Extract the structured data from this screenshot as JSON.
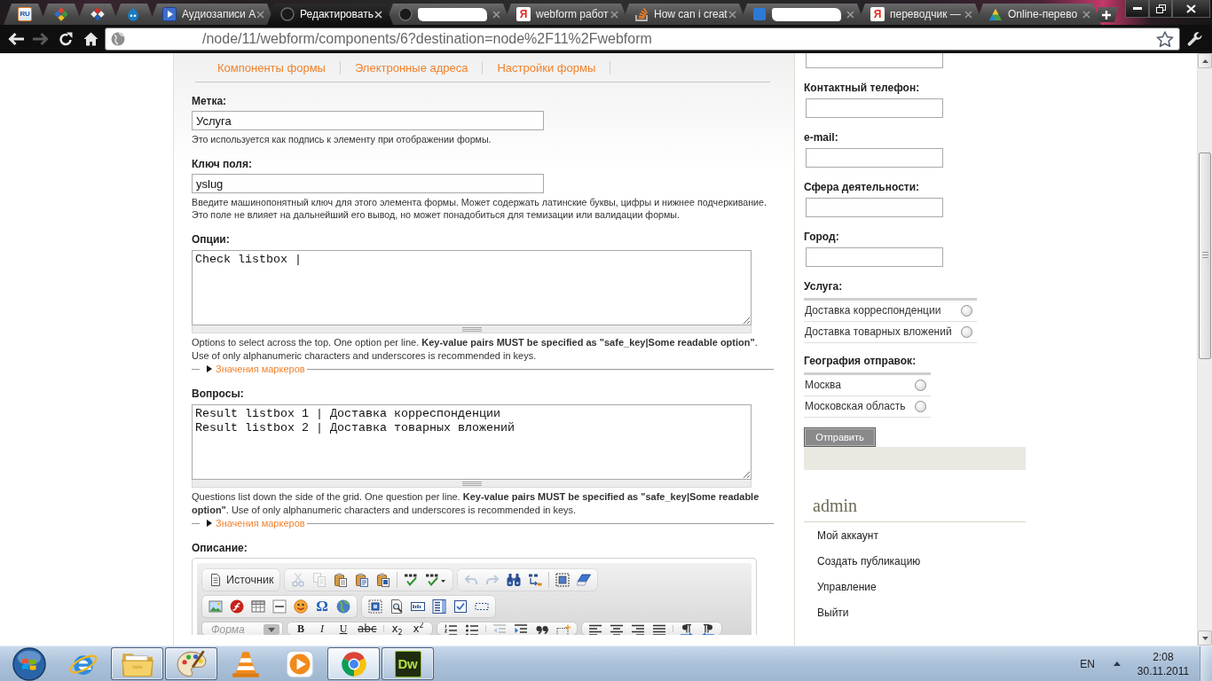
{
  "browser": {
    "tabs": [
      {
        "kind": "pinned",
        "icon_text": "RU",
        "selected": false
      },
      {
        "kind": "pinned",
        "selected": false
      },
      {
        "kind": "pinned",
        "selected": false
      },
      {
        "kind": "pinned",
        "selected": false
      },
      {
        "kind": "page",
        "title": "Аудиозаписи А",
        "selected": false
      },
      {
        "kind": "page",
        "title": "Редактировать",
        "selected": true
      },
      {
        "kind": "redacted",
        "selected": false
      },
      {
        "kind": "page",
        "title": "webform работ",
        "icon_text": "Я",
        "selected": false
      },
      {
        "kind": "page",
        "title": "How can i creat",
        "selected": false
      },
      {
        "kind": "redacted",
        "selected": false
      },
      {
        "kind": "page",
        "title": "переводчик —",
        "icon_text": "Я",
        "selected": false
      },
      {
        "kind": "page",
        "title": "Online-перево",
        "selected": false
      }
    ],
    "back_disabled": false,
    "forward_disabled": true,
    "address": "/node/11/webform/components/6?destination=node%2F11%2Fwebform"
  },
  "form_tabs": [
    "Компоненты формы",
    "Электронные адреса",
    "Настройки формы"
  ],
  "fields": [
    {
      "kind": "text",
      "label": "Метка:",
      "value": "Услуга",
      "description": "Это используется как подпись к элементу при отображении формы."
    },
    {
      "kind": "text",
      "label": "Ключ поля:",
      "value": "yslug",
      "description": "Введите машинопонятный ключ для этого элемента формы. Может содержать латинские буквы, цифры и нижнее подчеркивание. Это поле не влияет на дальнейший его вывод, но может понадобиться для темизации или валидации формы."
    },
    {
      "kind": "textarea",
      "label": "Опции:",
      "value": "Check listbox |",
      "description": "Options to select across the top. One option per line. **Key-value pairs MUST be specified as \"safe_key|Some readable option\"**. Use of only alphanumeric characters and underscores is recommended in keys.",
      "fieldset": {
        "title": "Значения маркеров",
        "expanded": false
      }
    },
    {
      "kind": "textarea",
      "label": "Вопросы:",
      "value": "Result listbox 1 | Доставка корреспонденции\nResult listbox 2 | Доставка товарных вложений",
      "description": "Questions list down the side of the grid. One question per line. **Key-value pairs MUST be specified as \"safe_key|Some readable option\"**. Use of only alphanumeric characters and underscores is recommended in keys.",
      "fieldset": {
        "title": "Значения маркеров",
        "expanded": false
      }
    },
    {
      "kind": "editor",
      "label": "Описание:",
      "toolbar": [
        [
          {
            "kind": "buttons",
            "sections": [
              [
                {
                  "kind": "source",
                  "label": "Источник",
                  "disabled": false
                }
              ]
            ]
          },
          {
            "kind": "buttons",
            "sections": [
              [
                {
                  "kind": "cut",
                  "disabled": true
                },
                {
                  "kind": "copy",
                  "disabled": true
                },
                {
                  "kind": "paste",
                  "disabled": false
                },
                {
                  "kind": "pastetext",
                  "disabled": false
                },
                {
                  "kind": "pasteword",
                  "disabled": false
                }
              ],
              [
                {
                  "kind": "spellcheck",
                  "disabled": false
                },
                {
                  "kind": "scayt",
                  "disabled": false
                }
              ]
            ]
          },
          {
            "kind": "buttons",
            "sections": [
              [
                {
                  "kind": "undo",
                  "disabled": true
                },
                {
                  "kind": "redo",
                  "disabled": true
                },
                {
                  "kind": "find",
                  "disabled": false
                },
                {
                  "kind": "replace",
                  "disabled": false
                }
              ],
              [
                {
                  "kind": "selectall",
                  "disabled": false
                },
                {
                  "kind": "removeformat",
                  "disabled": false
                }
              ]
            ]
          }
        ],
        [
          {
            "kind": "buttons",
            "sections": [
              [
                {
                  "kind": "image",
                  "disabled": false
                },
                {
                  "kind": "flash",
                  "disabled": false
                },
                {
                  "kind": "table",
                  "disabled": false
                },
                {
                  "kind": "hrule",
                  "disabled": false
                },
                {
                  "kind": "smiley",
                  "disabled": false
                },
                {
                  "kind": "specialchar",
                  "glyph": "Ω",
                  "disabled": false
                },
                {
                  "kind": "iframe",
                  "disabled": false
                }
              ]
            ]
          },
          {
            "kind": "buttons",
            "sections": [
              [
                {
                  "kind": "form",
                  "disabled": false
                },
                {
                  "kind": "imagebutton",
                  "disabled": false
                },
                {
                  "kind": "textfield",
                  "disabled": false
                },
                {
                  "kind": "select",
                  "disabled": false
                },
                {
                  "kind": "checkbox",
                  "disabled": false
                },
                {
                  "kind": "hiddenfield",
                  "disabled": false
                }
              ]
            ]
          }
        ],
        [
          {
            "kind": "combo",
            "label": "Форма"
          },
          {
            "kind": "buttons",
            "sections": [
              [
                {
                  "kind": "bold",
                  "glyph": "B",
                  "disabled": false
                },
                {
                  "kind": "italic",
                  "glyph": "I",
                  "disabled": false
                },
                {
                  "kind": "underline",
                  "glyph": "U",
                  "disabled": false
                },
                {
                  "kind": "strike",
                  "glyph": "abc",
                  "disabled": false
                }
              ],
              [
                {
                  "kind": "subscript",
                  "glyph": "x$_{2}$",
                  "disabled": false
                },
                {
                  "kind": "superscript",
                  "glyph": "x$^{2}$",
                  "disabled": false
                }
              ]
            ]
          },
          {
            "kind": "buttons",
            "sections": [
              [
                {
                  "kind": "numlist",
                  "disabled": false
                },
                {
                  "kind": "bullist",
                  "disabled": false
                }
              ],
              [
                {
                  "kind": "outdent",
                  "disabled": true
                },
                {
                  "kind": "indent",
                  "disabled": false
                },
                {
                  "kind": "blockquote",
                  "disabled": false
                },
                {
                  "kind": "creatediv",
                  "disabled": false
                }
              ]
            ]
          },
          {
            "kind": "buttons",
            "sections": [
              [
                {
                  "kind": "alignleft",
                  "disabled": false
                },
                {
                  "kind": "aligncenter",
                  "disabled": false
                },
                {
                  "kind": "alignright",
                  "disabled": false
                },
                {
                  "kind": "justify",
                  "disabled": false
                }
              ],
              [
                {
                  "kind": "ltr",
                  "disabled": false
                },
                {
                  "kind": "rtl",
                  "disabled": false
                }
              ]
            ]
          }
        ]
      ]
    }
  ],
  "sidebar": {
    "fields": [
      {
        "kind": "input"
      },
      {
        "kind": "input",
        "label": "Контактный телефон:"
      },
      {
        "kind": "input",
        "label": "e-mail:"
      },
      {
        "kind": "input",
        "label": "Сфера деятельности:"
      },
      {
        "kind": "input",
        "label": "Город:"
      },
      {
        "kind": "radios",
        "label": "Услуга:",
        "options": [
          {
            "label": "Доставка корреспонденции",
            "selected": false
          },
          {
            "label": "Доставка товарных вложений",
            "selected": false
          }
        ]
      },
      {
        "kind": "radios",
        "label": "География отправок:",
        "options": [
          {
            "label": "Москва",
            "selected": false
          },
          {
            "label": "Московская область",
            "selected": false
          }
        ]
      }
    ],
    "submit": "Отправить",
    "user_menu": {
      "title": "admin",
      "links": [
        "Мой аккаунт",
        "Создать публикацию",
        "Управление",
        "Выйти"
      ]
    }
  },
  "taskbar": {
    "apps": [
      {
        "running": false,
        "selected": false
      },
      {
        "running": true,
        "selected": false
      },
      {
        "running": true,
        "selected": false
      },
      {
        "running": false,
        "selected": false
      },
      {
        "running": false,
        "selected": false
      },
      {
        "running": true,
        "selected": true
      },
      {
        "running": true,
        "selected": false,
        "icon_text": "Dw"
      }
    ],
    "language": "EN",
    "time": "2:08",
    "date": "30.11.2011"
  }
}
